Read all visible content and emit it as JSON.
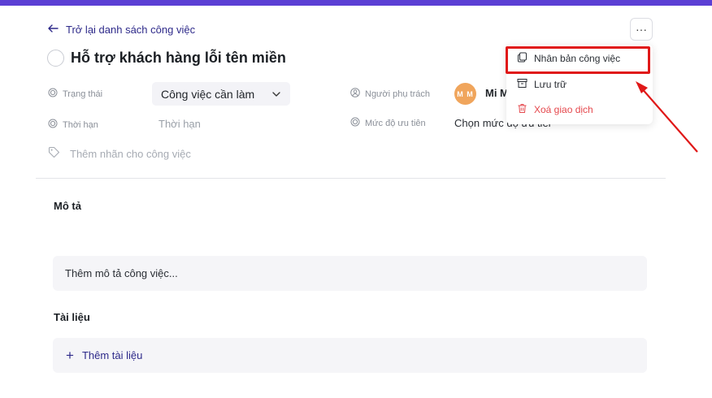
{
  "header": {
    "back_label": "Trở lại danh sách công việc",
    "more_label": "···"
  },
  "task": {
    "title": "Hỗ trợ khách hàng lỗi tên miền"
  },
  "fields": {
    "status_label": "Trạng thái",
    "status_value": "Công việc cần làm",
    "deadline_label": "Thời hạn",
    "deadline_placeholder": "Thời hạn",
    "assignee_label": "Người phụ trách",
    "assignee_initials": "M M",
    "assignee_name": "Mi M",
    "priority_label": "Mức độ ưu tiên",
    "priority_placeholder": "Chọn mức độ ưu tiên",
    "tag_placeholder": "Thêm nhãn cho công việc"
  },
  "description": {
    "title": "Mô tả",
    "placeholder": "Thêm mô tả công việc..."
  },
  "documents": {
    "title": "Tài liệu",
    "add_label": "Thêm tài liệu"
  },
  "menu": {
    "items": [
      {
        "label": "Nhân bản công việc",
        "icon": "copy-icon"
      },
      {
        "label": "Lưu trữ",
        "icon": "archive-icon"
      },
      {
        "label": "Xoá giao dịch",
        "icon": "trash-icon"
      }
    ]
  },
  "colors": {
    "accent": "#5b3fd4",
    "link": "#2e2a8a",
    "danger": "#e5484d",
    "highlight": "#e01818",
    "avatar": "#f0a55c"
  }
}
